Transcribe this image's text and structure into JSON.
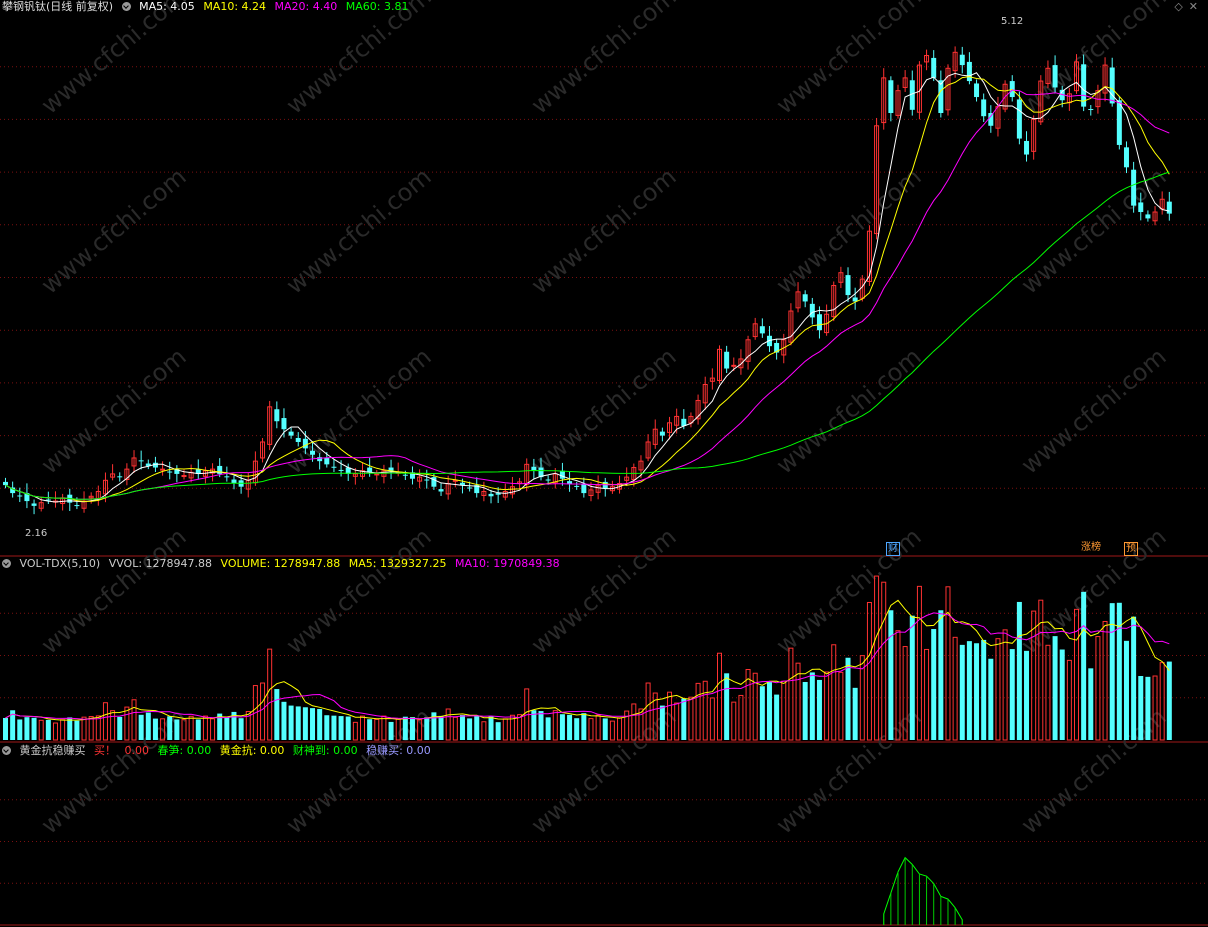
{
  "main_panel": {
    "title": "攀钢钒钛(日线 前复权)",
    "indicators": [
      {
        "label": "MA5: 4.05",
        "color": "#ffffff"
      },
      {
        "label": "MA10: 4.24",
        "color": "#ffff00"
      },
      {
        "label": "MA20: 4.40",
        "color": "#ff00ff"
      },
      {
        "label": "MA60: 3.81",
        "color": "#00ff00"
      }
    ],
    "high_label": "5.12",
    "low_label": "2.16",
    "event_marks": [
      {
        "text": "财",
        "color": "#4da6ff"
      },
      {
        "text": "涨榜",
        "color": "#ff9933"
      },
      {
        "text": "预",
        "color": "#ff9933"
      }
    ]
  },
  "vol_panel": {
    "title": "VOL-TDX(5,10)",
    "indicators": [
      {
        "label": "VVOL: 1278947.88",
        "color": "#cccccc"
      },
      {
        "label": "VOLUME: 1278947.88",
        "color": "#ffff00"
      },
      {
        "label": "MA5: 1329327.25",
        "color": "#ffff00"
      },
      {
        "label": "MA10: 1970849.38",
        "color": "#ff00ff"
      }
    ]
  },
  "ind_panel": {
    "title": "黄金抗稳赚买",
    "indicators": [
      {
        "label": "买！",
        "color": "#ff3333"
      },
      {
        "label": "0.00",
        "color": "#ff3333"
      },
      {
        "label": "春笋: 0.00",
        "color": "#00ff00"
      },
      {
        "label": "黄金抗: 0.00",
        "color": "#ffff00"
      },
      {
        "label": "财神到: 0.00",
        "color": "#00ff00"
      },
      {
        "label": "稳赚买: 0.00",
        "color": "#9999ff"
      }
    ]
  },
  "watermark": "www.cfchi.com",
  "colors": {
    "up": "#ff3232",
    "down": "#54ffff",
    "ma5": "#ffffff",
    "ma10": "#ffff00",
    "ma20": "#ff00ff",
    "ma60": "#00ff00",
    "grid": "#7a1010"
  },
  "chart_data": {
    "type": "candlestick",
    "price_close": [
      2.35,
      2.3,
      2.28,
      2.25,
      2.22,
      2.24,
      2.26,
      2.25,
      2.27,
      2.24,
      2.22,
      2.25,
      2.28,
      2.31,
      2.38,
      2.42,
      2.4,
      2.45,
      2.52,
      2.5,
      2.47,
      2.46,
      2.45,
      2.43,
      2.42,
      2.41,
      2.43,
      2.42,
      2.44,
      2.45,
      2.42,
      2.4,
      2.36,
      2.34,
      2.38,
      2.5,
      2.62,
      2.84,
      2.75,
      2.7,
      2.66,
      2.62,
      2.58,
      2.54,
      2.5,
      2.48,
      2.46,
      2.44,
      2.42,
      2.42,
      2.44,
      2.43,
      2.42,
      2.44,
      2.44,
      2.43,
      2.41,
      2.39,
      2.4,
      2.38,
      2.34,
      2.31,
      2.36,
      2.38,
      2.35,
      2.33,
      2.3,
      2.31,
      2.28,
      2.29,
      2.31,
      2.34,
      2.37,
      2.48,
      2.44,
      2.4,
      2.38,
      2.42,
      2.39,
      2.36,
      2.34,
      2.3,
      2.32,
      2.35,
      2.33,
      2.34,
      2.36,
      2.4,
      2.46,
      2.5,
      2.62,
      2.7,
      2.66,
      2.74,
      2.78,
      2.72,
      2.78,
      2.88,
      2.98,
      3.02,
      3.2,
      3.08,
      3.1,
      3.14,
      3.26,
      3.36,
      3.3,
      3.22,
      3.18,
      3.26,
      3.44,
      3.56,
      3.5,
      3.4,
      3.32,
      3.42,
      3.6,
      3.68,
      3.54,
      3.5,
      3.64,
      3.94,
      4.6,
      4.9,
      4.68,
      4.82,
      4.9,
      4.7,
      4.98,
      5.04,
      4.9,
      4.68,
      4.96,
      5.06,
      4.98,
      4.88,
      4.78,
      4.66,
      4.6,
      4.72,
      4.86,
      4.78,
      4.52,
      4.42,
      4.64,
      4.88,
      4.96,
      4.84,
      4.76,
      4.8,
      5.0,
      4.72,
      4.7,
      4.82,
      4.98,
      4.74,
      4.48,
      4.34,
      4.1,
      4.06,
      4.02,
      4.06,
      4.14,
      4.05
    ],
    "price_ylim": [
      2.0,
      5.3
    ],
    "volume_ylim": [
      0,
      5200000
    ],
    "indicator_ylim": [
      0,
      1.3
    ],
    "ma_periods": [
      5,
      10,
      20,
      60
    ],
    "volume_ma_periods": [
      5,
      10
    ],
    "xlabel": "",
    "ylabel": ""
  }
}
